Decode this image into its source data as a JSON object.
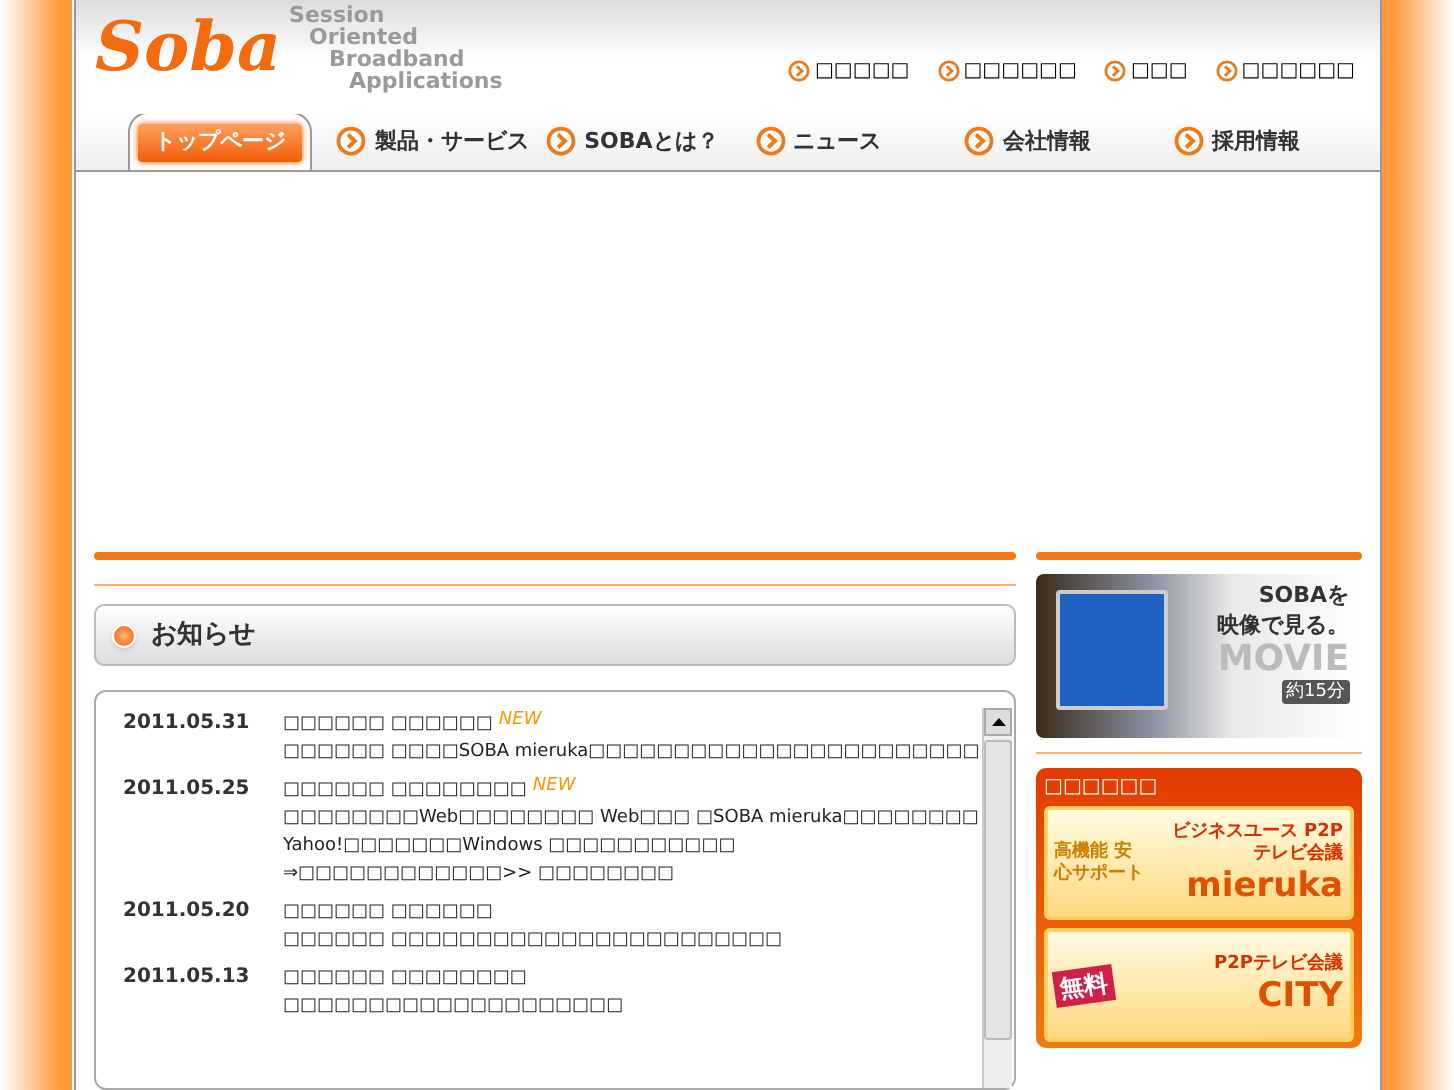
{
  "logo": {
    "mark": "Soba",
    "tagline": [
      "Session",
      "Oriented",
      "Broadband",
      "Applications"
    ]
  },
  "utility_links": [
    "□□□□□",
    "□□□□□□",
    "□□□",
    "□□□□□□"
  ],
  "nav": [
    {
      "label": "トップページ",
      "selected": true
    },
    {
      "label": "製品・サービス",
      "selected": false
    },
    {
      "label": "SOBAとは？",
      "selected": false
    },
    {
      "label": "ニュース",
      "selected": false
    },
    {
      "label": "会社情報",
      "selected": false
    },
    {
      "label": "採用情報",
      "selected": false
    }
  ],
  "news_heading": "お知らせ",
  "news": [
    {
      "date": "2011.05.31",
      "title": "□□□□□□ □□□□□□",
      "badge": "NEW",
      "lines": [
        "□□□□□□ □□□□SOBA mieruka□□□□□□□□□□□□□□□□□□□□□□□"
      ]
    },
    {
      "date": "2011.05.25",
      "title": "□□□□□□ □□□□□□□□",
      "badge": "NEW",
      "lines": [
        "□□□□□□□□Web□□□□□□□□ Web□□□ □SOBA mieruka□□□□□□□□",
        "Yahoo!□□□□□□□Windows □□□□□□□□□□□",
        "⇒□□□□□□□□□□□□>> □□□□□□□□"
      ]
    },
    {
      "date": "2011.05.20",
      "title": "□□□□□□ □□□□□□",
      "lines": [
        "□□□□□□ □□□□□□□□□□□□□□□□□□□□□□□"
      ]
    },
    {
      "date": "2011.05.13",
      "title": "□□□□□□ □□□□□□□□",
      "lines": [
        "□□□□□□□□□□□□□□□□□□□□"
      ]
    }
  ],
  "movie_banner": {
    "line_1": "SOBAを",
    "line_2": "映像で見る。",
    "word": "MOVIE",
    "duration": "約15分"
  },
  "product_box": {
    "heading": "□□□□□□",
    "banners": [
      {
        "badge": "高機能 安心サポート",
        "headline": "ビジネスユース P2Pテレビ会議",
        "brand": "mieruka"
      },
      {
        "badge": "無料",
        "headline": "P2Pテレビ会議",
        "brand": "CITY"
      }
    ]
  }
}
